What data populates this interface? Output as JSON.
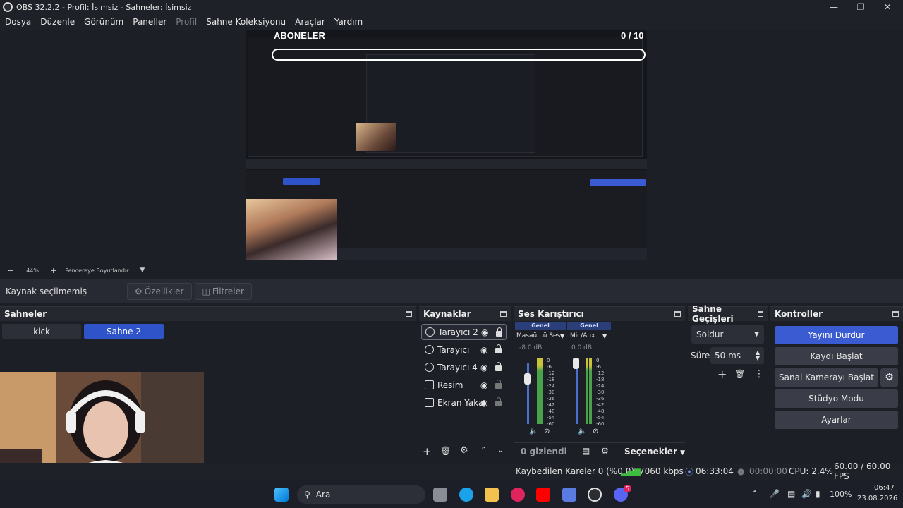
{
  "window": {
    "title": "OBS 32.2.2 - Profil: İsimsiz - Sahneler: İsimsiz",
    "min_icon": "minimize-icon",
    "max_icon": "maximize-icon",
    "close_icon": "close-icon"
  },
  "menu": [
    "Dosya",
    "Düzenle",
    "Görünüm",
    "Paneller",
    "Profil",
    "Sahne Koleksiyonu",
    "Araçlar",
    "Yardım"
  ],
  "overlay": {
    "label": "ABONELER",
    "count": "0 / 10"
  },
  "zoom": {
    "minus": "−",
    "value": "44%",
    "plus": "+",
    "fit": "Pencereye Boyutlandır"
  },
  "source_bar": {
    "label": "Kaynak seçilmemiş",
    "properties": "Özellikler",
    "filters": "Filtreler"
  },
  "scenes": {
    "title": "Sahneler",
    "items": [
      {
        "label": "kick",
        "active": false
      },
      {
        "label": "Sahne 2",
        "active": true
      }
    ]
  },
  "sources": {
    "title": "Kaynaklar",
    "items": [
      {
        "label": "Tarayıcı 2",
        "icon": "globe-icon",
        "locked": true
      },
      {
        "label": "Tarayıcı",
        "icon": "globe-icon",
        "locked": true
      },
      {
        "label": "Tarayıcı 4",
        "icon": "globe-icon",
        "locked": true
      },
      {
        "label": "Resim",
        "icon": "image-icon",
        "locked": false
      },
      {
        "label": "Ekran Yaka",
        "icon": "monitor-icon",
        "locked": false
      }
    ]
  },
  "mixer": {
    "title": "Ses Karıştırıcı",
    "channels": [
      {
        "tag": "Genel",
        "name": "Masaü...ü Ses",
        "db": "-8.0 dB",
        "level": 0.55
      },
      {
        "tag": "Genel",
        "name": "Mic/Aux",
        "db": "0.0 dB",
        "level": 0.9
      }
    ],
    "ticks": [
      "0",
      "-6",
      "-12",
      "-18",
      "-24",
      "-30",
      "-36",
      "-42",
      "-48",
      "-54",
      "-60"
    ],
    "hidden": "0 gizlendi",
    "options": "Seçenekler"
  },
  "transitions": {
    "title": "Sahne Geçişleri",
    "type": "Soldur",
    "duration_label": "Süre",
    "duration": "50 ms"
  },
  "controls": {
    "title": "Kontroller",
    "buttons": [
      "Yayını Durdur",
      "Kaydı Başlat",
      "Sanal Kamerayı Başlat",
      "Stüdyo Modu",
      "Ayarlar"
    ]
  },
  "status": {
    "dropped": "Kaybedilen Kareler 0 (%0.0)",
    "bitrate": "7060 kbps",
    "stream_time": "06:33:04",
    "rec_time": "00:00:00",
    "cpu": "CPU: 2.4%",
    "fps": "60.00 / 60.00 FPS"
  },
  "taskbar": {
    "search": "Ara",
    "battery": "100%",
    "time": "06:47",
    "date": "23.08.2026",
    "badge": "5"
  },
  "colors": {
    "accent": "#3a5bd1",
    "active_scene": "#2f54c9",
    "background": "#1d1f26"
  }
}
